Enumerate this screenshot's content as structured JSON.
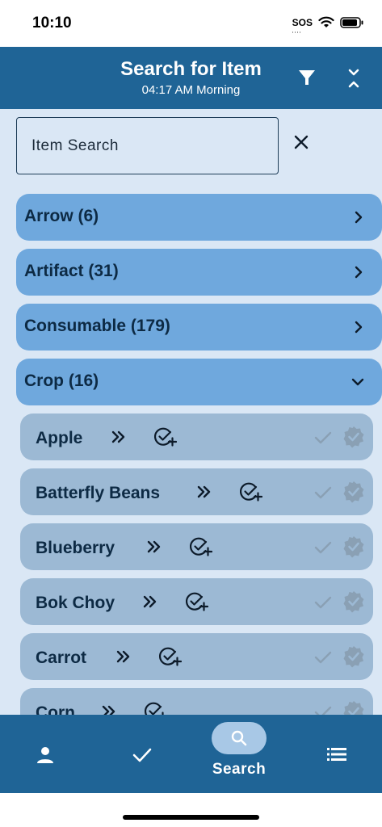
{
  "status_bar": {
    "time": "10:10",
    "sos": "SOS",
    "sos_dots": "····"
  },
  "header": {
    "title": "Search for Item",
    "subtitle": "04:17 AM Morning"
  },
  "search": {
    "placeholder": "Item Search",
    "value": ""
  },
  "categories": [
    {
      "label": "Arrow (6)",
      "expanded": false
    },
    {
      "label": "Artifact (31)",
      "expanded": false
    },
    {
      "label": "Consumable (179)",
      "expanded": false
    },
    {
      "label": "Crop (16)",
      "expanded": true
    }
  ],
  "items": [
    {
      "name": "Apple"
    },
    {
      "name": "Batterfly Beans"
    },
    {
      "name": "Blueberry"
    },
    {
      "name": "Bok Choy"
    },
    {
      "name": "Carrot"
    },
    {
      "name": "Corn"
    }
  ],
  "bottom_nav": {
    "active_label": "Search"
  },
  "icons": {
    "filter": "filter-icon",
    "collapse": "collapse-all-icon",
    "clear": "close-icon",
    "chevron_right": "chevron-right-icon",
    "chevron_down": "chevron-down-icon",
    "forward": "double-chevron-right-icon",
    "add_check": "check-circle-plus-icon",
    "check": "check-icon",
    "badge": "verified-badge-icon",
    "person": "person-icon",
    "search": "search-icon",
    "list": "list-icon"
  },
  "colors": {
    "primary": "#1f6496",
    "background": "#dae7f5",
    "category": "#6fa8dd",
    "item": "#9cb9d4",
    "text_dark": "#0d2a44",
    "muted_icon": "#8aa0b4"
  }
}
